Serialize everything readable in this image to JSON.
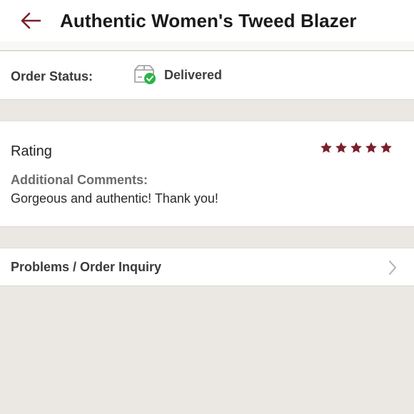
{
  "header": {
    "title": "Authentic Women's Tweed Blazer",
    "back_icon": "arrow-left-icon",
    "accent_color": "#7b1f2b"
  },
  "order": {
    "label": "Order Status:",
    "status": "Delivered",
    "status_icon": "package-delivered-icon",
    "status_color": "#2cb34a"
  },
  "review": {
    "rating_label": "Rating",
    "rating_value": 5,
    "rating_max": 5,
    "star_color": "#7b1f2b",
    "comments_label": "Additional Comments:",
    "comments_text": "Gorgeous and authentic! Thank you!"
  },
  "problems": {
    "label": "Problems / Order Inquiry",
    "chevron_icon": "chevron-right-icon"
  }
}
